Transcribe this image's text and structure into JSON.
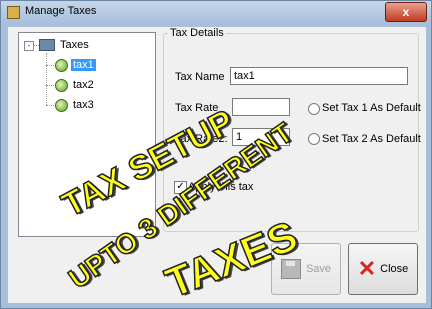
{
  "window": {
    "title": "Manage Taxes",
    "close_glyph": "x"
  },
  "tree": {
    "root": {
      "label": "Taxes",
      "expander": "-"
    },
    "items": [
      {
        "label": "tax1",
        "selected": true
      },
      {
        "label": "tax2",
        "selected": false
      },
      {
        "label": "tax3",
        "selected": false
      }
    ]
  },
  "details": {
    "legend": "Tax Details",
    "tax_name_label": "Tax Name",
    "tax_name_value": "tax1",
    "tax_rate_label": "Tax Rate",
    "tax_rate_value": "",
    "set_tax1_label": "Set Tax 1 As Default",
    "tax_rate2_label": "Tax Rate2:",
    "tax_rate2_value": "1",
    "set_tax2_label": "Set Tax 2 As Default",
    "apply_label": "Apply this tax",
    "apply_checked": true
  },
  "buttons": {
    "save_label": "Save",
    "save_enabled": false,
    "close_label": "Close"
  },
  "overlay": {
    "line1": "TAX SETUP",
    "line2": "UPTO 3 DIFFERENT",
    "line3": "TAXES"
  },
  "icons": [
    "app-icon",
    "folder-icon",
    "leaf-icon",
    "save-icon",
    "close-x-icon"
  ]
}
